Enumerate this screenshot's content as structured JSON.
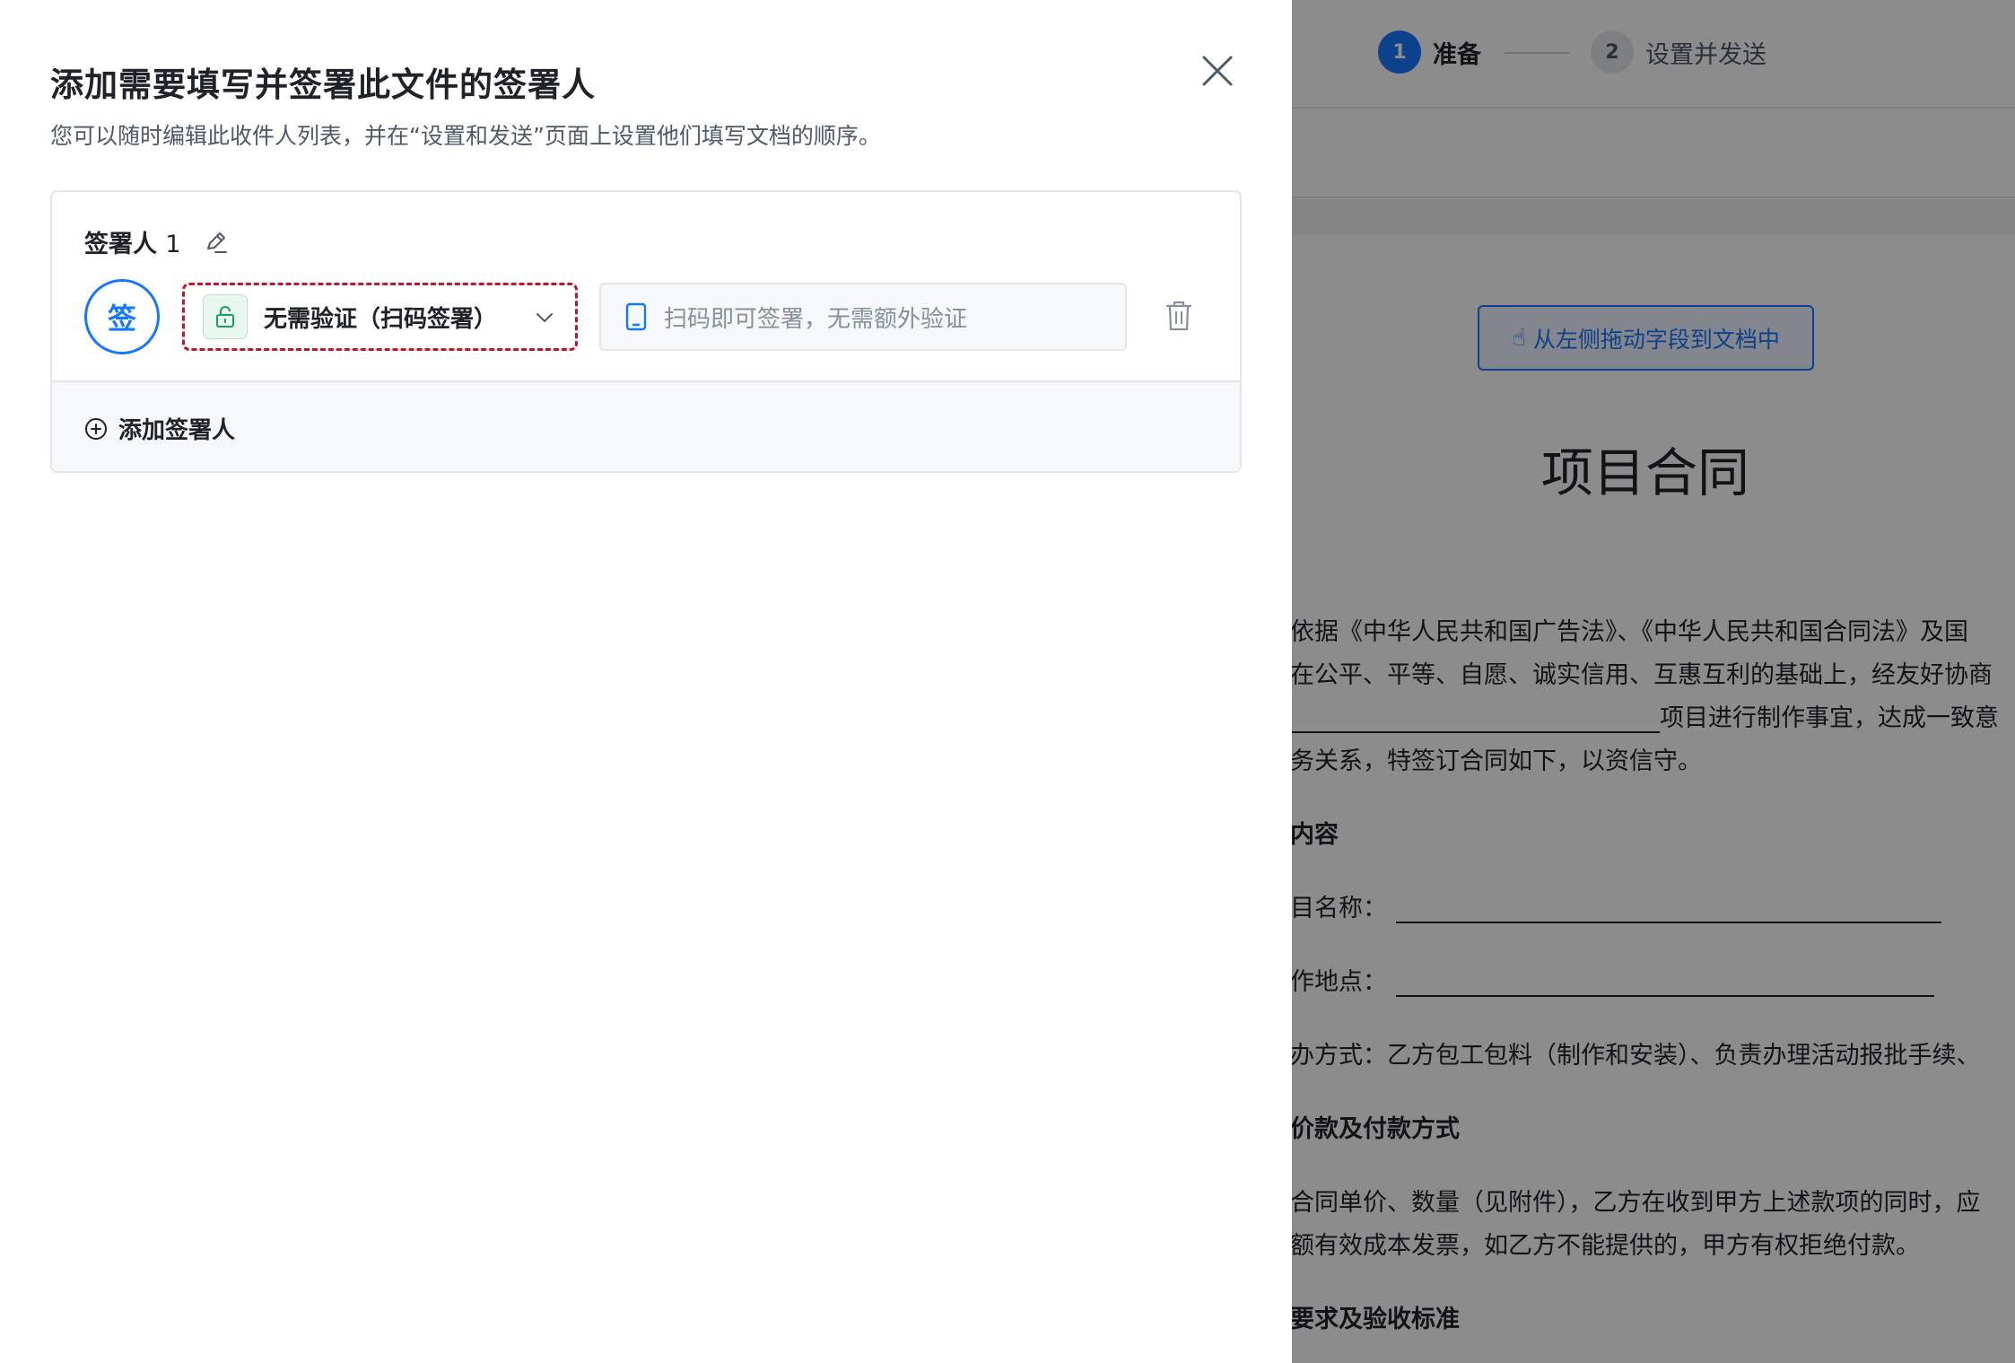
{
  "stepper": {
    "steps": [
      {
        "number": "1",
        "label": "准备"
      },
      {
        "number": "2",
        "label": "设置并发送"
      }
    ]
  },
  "document": {
    "drag_hint": "从左侧拖动字段到文档中",
    "title": "项目合同",
    "lines": [
      "依据《中华人民共和国广告法》、《中华人民共和国合同法》及国",
      "在公平、平等、自愿、诚实信用、互惠互利的基础上，经友好协商",
      "项目进行制作事宜，达成一致意",
      "务关系，特签订合同如下，以资信守。",
      "内容",
      "目名称：",
      "作地点：",
      "办方式：乙方包工包料（制作和安装）、负责办理活动报批手续、",
      "价款及付款方式",
      "合同单价、数量（见附件），乙方在收到甲方上述款项的同时，应",
      "额有效成本发票，如乙方不能提供的，甲方有权拒绝付款。",
      "要求及验收标准"
    ]
  },
  "drawer": {
    "title": "添加需要填写并签署此文件的签署人",
    "subtitle": "您可以随时编辑此收件人列表，并在“设置和发送”页面上设置他们填写文档的顺序。",
    "signer": {
      "name": "签署人",
      "number": "1",
      "avatar_text": "签",
      "verification_selected": "无需验证（扫码签署）",
      "verification_description": "扫码即可签署，无需额外验证"
    },
    "add_signer_label": "添加签署人"
  },
  "colors": {
    "accent": "#1677ff",
    "select_border": "#c4162a",
    "lock_green": "#1aa05a"
  }
}
